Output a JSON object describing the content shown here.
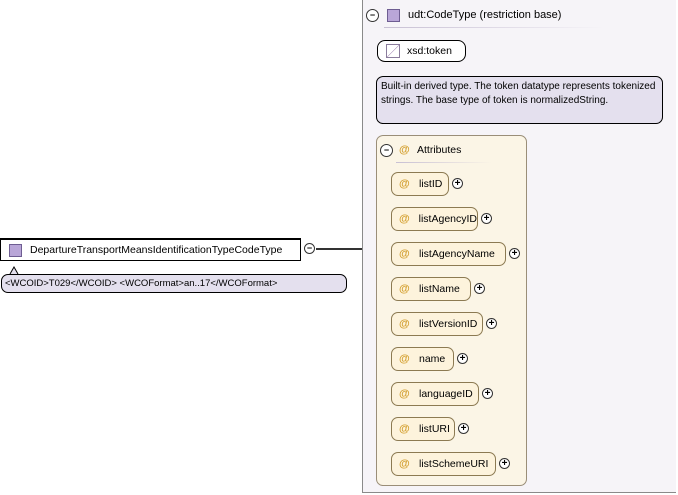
{
  "element": {
    "name": "DepartureTransportMeansIdentificationTypeCodeType",
    "documentation": "<WCOID>T029</WCOID> <WCOFormat>an..17</WCOFormat>"
  },
  "type_panel": {
    "title": "udt:CodeType (restriction base)",
    "base_type": "xsd:token",
    "description": "Built-in derived type. The token datatype represents tokenized strings. The base type of token is normalizedString."
  },
  "attributes": {
    "title": "Attributes",
    "items": [
      {
        "label": "listID"
      },
      {
        "label": "listAgencyID"
      },
      {
        "label": "listAgencyName"
      },
      {
        "label": "listName"
      },
      {
        "label": "listVersionID"
      },
      {
        "label": "name"
      },
      {
        "label": "languageID"
      },
      {
        "label": "listURI"
      },
      {
        "label": "listSchemeURI"
      }
    ]
  },
  "icons": {
    "collapse": "minus-circle-icon",
    "expand": "plus-circle-icon",
    "attribute": "at-sign-icon",
    "type": "square-type-icon",
    "simple_type": "token-icon"
  },
  "colors": {
    "panel_bg": "#f6f4f8",
    "doc_bg": "#e4e0ee",
    "attribute_bg": "#fdf3dc",
    "attribute_symbol": "#d4a030",
    "type_square": "#b9a6d8"
  }
}
